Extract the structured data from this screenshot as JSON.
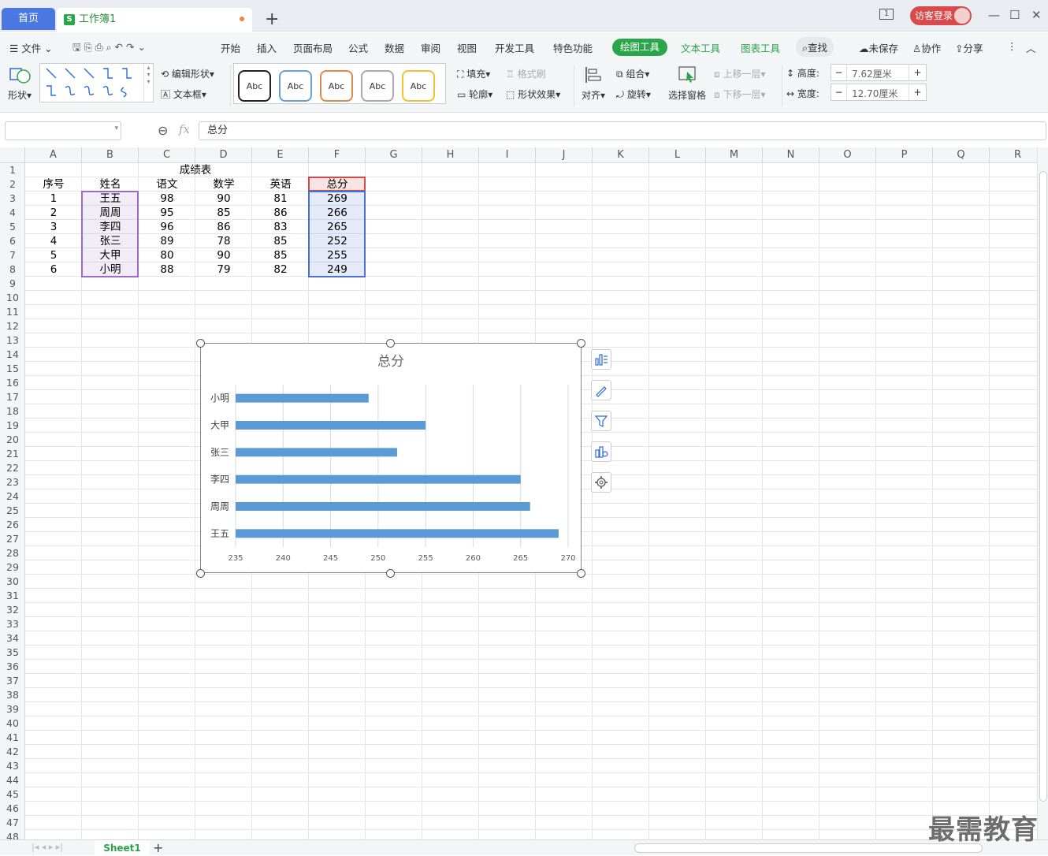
{
  "titlebar": {
    "home_tab": "首页",
    "doc_tab": "工作簿1",
    "doc_icon": "S",
    "new_tab": "+",
    "login": "访客登录",
    "win_icons": [
      "□",
      "—",
      "☐",
      "✕"
    ]
  },
  "menubar": {
    "file": "文件",
    "items": [
      "开始",
      "插入",
      "页面布局",
      "公式",
      "数据",
      "审阅",
      "视图",
      "开发工具",
      "特色功能"
    ],
    "context_tabs": [
      "绘图工具",
      "文本工具",
      "图表工具"
    ],
    "search": "查找",
    "unsaved": "未保存",
    "collab": "协作",
    "share": "分享"
  },
  "ribbon": {
    "shape": "形状",
    "edit_shape": "编辑形状",
    "textbox": "文本框",
    "style_label": "Abc",
    "fill": "填充",
    "format_brush": "格式刷",
    "outline": "轮廓",
    "shape_effect": "形状效果",
    "align": "对齐",
    "group": "组合",
    "rotate": "旋转",
    "select_pane": "选择窗格",
    "bring_forward": "上移一层",
    "send_backward": "下移一层",
    "height_label": "高度:",
    "height_value": "7.62厘米",
    "width_label": "宽度:",
    "width_value": "12.70厘米"
  },
  "formula": {
    "namebox": "",
    "fx": "fx",
    "content": "总分"
  },
  "columns": [
    "A",
    "B",
    "C",
    "D",
    "E",
    "F",
    "G",
    "H",
    "I",
    "J",
    "K",
    "L",
    "M",
    "N",
    "O",
    "P",
    "Q",
    "R"
  ],
  "rows": [
    "1",
    "2",
    "3",
    "4",
    "5",
    "6",
    "7",
    "8",
    "9",
    "10",
    "11",
    "12",
    "13",
    "14",
    "15",
    "16",
    "17",
    "18",
    "19",
    "20",
    "21",
    "22",
    "23",
    "24",
    "25",
    "26",
    "27",
    "28",
    "29",
    "30",
    "31",
    "32",
    "33",
    "34",
    "35",
    "36",
    "37",
    "38",
    "39",
    "40",
    "41",
    "42",
    "43",
    "44",
    "45",
    "46",
    "47",
    "48"
  ],
  "table": {
    "title": "成绩表",
    "headers": [
      "序号",
      "姓名",
      "语文",
      "数学",
      "英语",
      "总分"
    ],
    "rows": [
      [
        "1",
        "王五",
        "98",
        "90",
        "81",
        "269"
      ],
      [
        "2",
        "周周",
        "95",
        "85",
        "86",
        "266"
      ],
      [
        "3",
        "李四",
        "96",
        "86",
        "83",
        "265"
      ],
      [
        "4",
        "张三",
        "89",
        "78",
        "85",
        "252"
      ],
      [
        "5",
        "大甲",
        "80",
        "90",
        "85",
        "255"
      ],
      [
        "6",
        "小明",
        "88",
        "79",
        "82",
        "249"
      ]
    ]
  },
  "chart_data": {
    "type": "bar",
    "orientation": "horizontal",
    "title": "总分",
    "categories": [
      "小明",
      "大甲",
      "张三",
      "李四",
      "周周",
      "王五"
    ],
    "values": [
      249,
      255,
      252,
      265,
      266,
      269
    ],
    "xlim": [
      235,
      270
    ],
    "xticks": [
      "235",
      "240",
      "245",
      "250",
      "255",
      "260",
      "265",
      "270"
    ],
    "bar_color": "#5b9bd5",
    "grid": "vertical",
    "legend": "none"
  },
  "sheets": {
    "active": "Sheet1",
    "add": "+"
  },
  "watermark": "最需教育"
}
